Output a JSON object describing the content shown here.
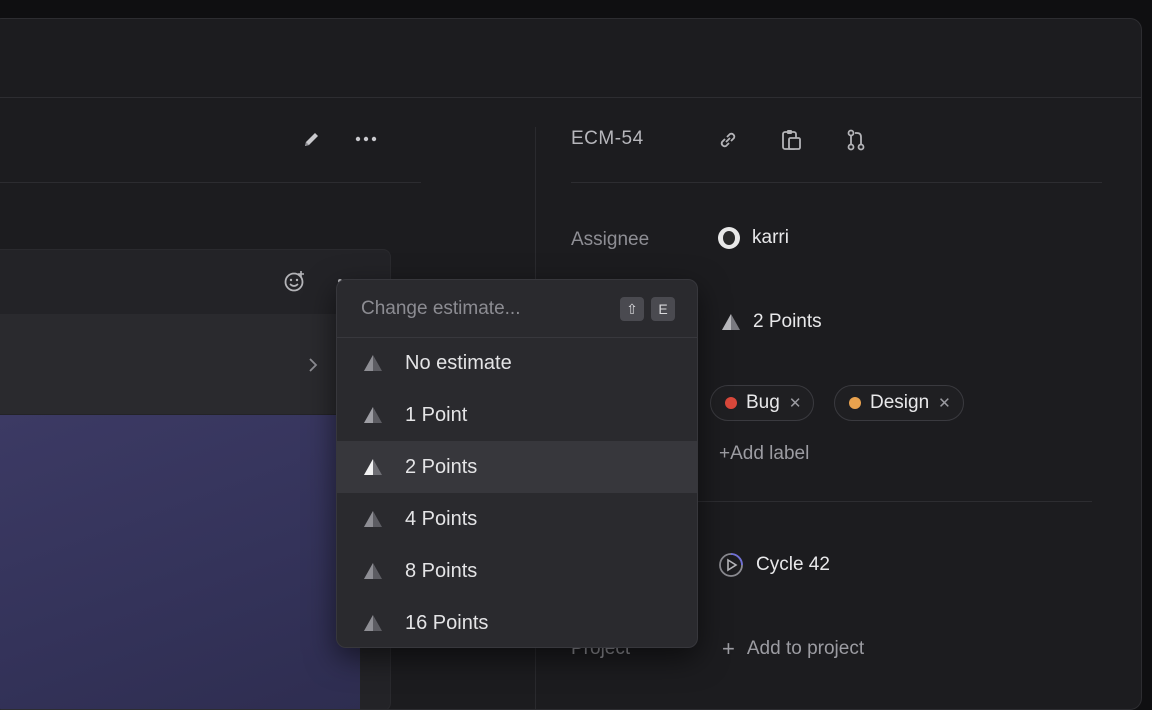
{
  "issue": {
    "id": "ECM-54"
  },
  "properties": {
    "assignee_label": "Assignee",
    "assignee_value": "karri",
    "estimate_value": "2 Points",
    "labels": [
      {
        "name": "Bug",
        "color": "#d9483b"
      },
      {
        "name": "Design",
        "color": "#e9a24e"
      }
    ],
    "add_label": "+Add label",
    "cycle_value": "Cycle 42",
    "project_label": "Project",
    "add_to_project": "Add to project"
  },
  "estimate_menu": {
    "placeholder": "Change estimate...",
    "shortcut_keys": [
      "⇧",
      "E"
    ],
    "options": [
      "No estimate",
      "1 Point",
      "2 Points",
      "4 Points",
      "8 Points",
      "16 Points"
    ],
    "selected": "2 Points"
  },
  "icons": {
    "edit": "pencil-icon",
    "more": "more-horizontal-icon",
    "link": "link-icon",
    "copy": "copy-clipboard-icon",
    "branch": "git-branch-icon",
    "emoji": "add-reaction-icon",
    "estimate": "triangle-estimate-icon",
    "cycle": "cycle-icon"
  },
  "colors": {
    "background": "#1c1c1f",
    "menu": "#2a2a2e",
    "selected_row": "#37373c"
  }
}
